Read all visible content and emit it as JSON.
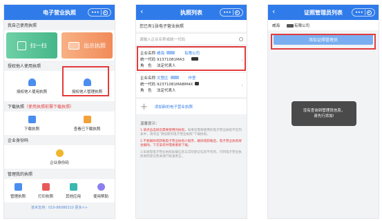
{
  "colors": {
    "brand_blue": "#2f7bea",
    "highlight_red": "#e23b3b",
    "button_green": "#45b78a",
    "button_orange": "#f18b5a"
  },
  "phone1": {
    "title": "电子营业执照",
    "section_used": "我自己使用执照",
    "scan_label": "扫一扫",
    "show_label": "出示执照",
    "section_auth": "授权他人使用执照",
    "auth_use_label": "授权他人使用执照",
    "auth_manager_label": "授权他人管理执照",
    "section_download": "下载执照",
    "section_download_note": "（使用执照前需下载执照）",
    "download_label": "下载执照",
    "view_downloaded_label": "查看已下载执照",
    "section_id": "企业身份码",
    "id_code_label": "企业身份码",
    "section_manage": "管理我的执照",
    "manage_items": [
      "管理执照",
      "打印执照",
      "其他应用",
      "使用帮助"
    ],
    "footer": "技术支持：010-86086310 更多>>"
  },
  "phone2": {
    "title": "执照列表",
    "owned_label": "您已有1张电子营业执照",
    "search_placeholder": "请输入企业名称或统一代码",
    "licenses": [
      {
        "name_key": "企业名称",
        "name_val": "威海",
        "name_suffix": "有限公司",
        "code_key": "统一代码",
        "code_val": "91371081MA3",
        "role_key": "角　色",
        "role_val": "法定代表人"
      },
      {
        "name_key": "企业名称",
        "name_val": "文登区",
        "name_suffix": "作室",
        "code_key": "统一代码",
        "code_val": "92371081MABM4X",
        "role_key": "角　色",
        "role_val": "法定代表人"
      }
    ],
    "add_label": "添加新的电子营业执照",
    "tips_title": "温馨提示：",
    "tip1": "1.请点击选择您需要使用的执照，",
    "tip1_rest": "如果您需要使用的电子营业执照不在列表中，请点击\"添加新的电子营业执照\"下载执照。",
    "tip2": "2.不要删除或卸载电子营业执照小程序，删除或卸载后，电子营业执照将会删除，下次安装时需要重新下载。",
    "tip3": "3.如发现电子营业执照加载信息与实际登记信息不符的，可到电子营业执照发照登记机关进行核查更正。"
  },
  "phone3": {
    "title": "证照管理员列表",
    "corp_prefix": "威海",
    "corp_suffix": "有限公司",
    "add_manager_label": "添加证照管理员",
    "toast_line1": "没有查询到管理员信息，",
    "toast_line2": "请先行添加!"
  }
}
